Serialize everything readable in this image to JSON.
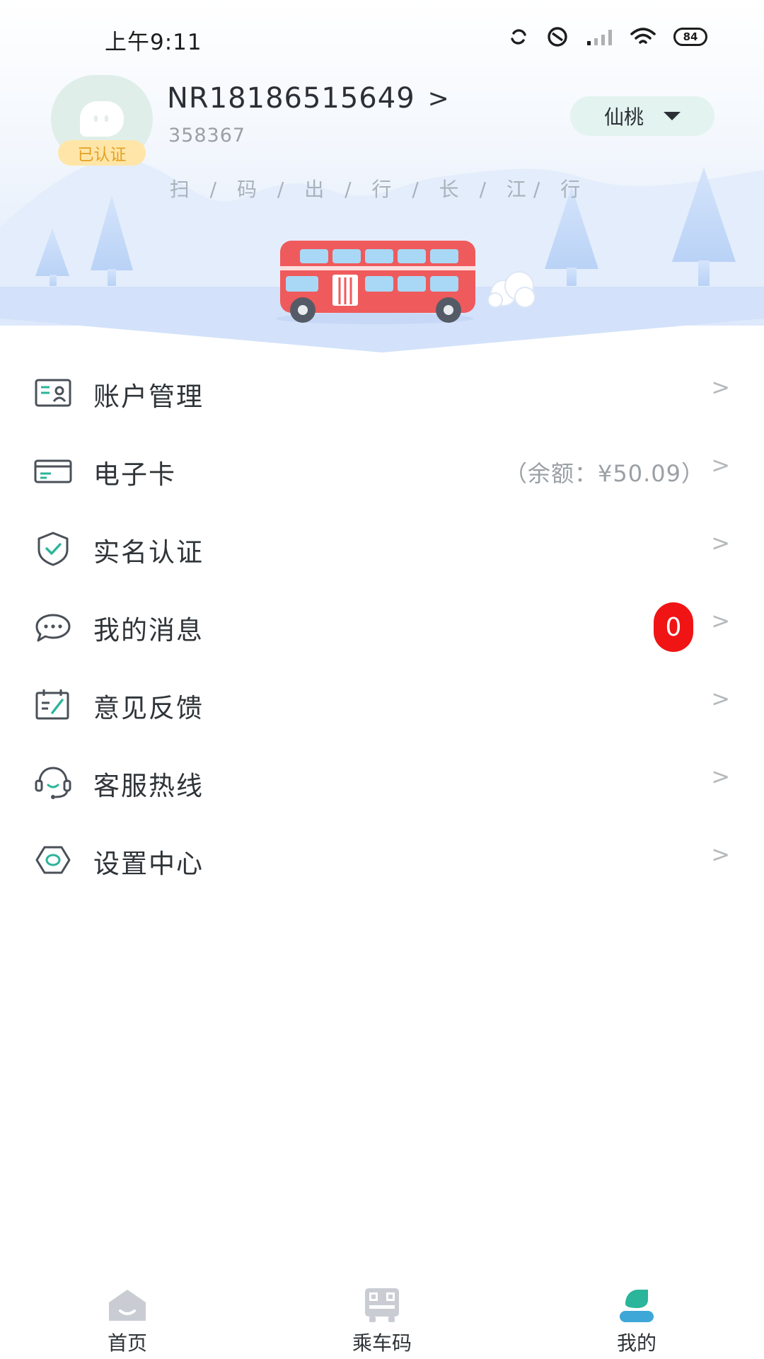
{
  "status_bar": {
    "time": "上午9:11",
    "battery": "84",
    "icons": [
      "sync-icon",
      "do-not-disturb-icon",
      "signal-icon",
      "wifi-icon",
      "battery-icon"
    ]
  },
  "profile": {
    "username": "NR18186515649",
    "chevron": ">",
    "user_id": "358367",
    "verified_badge": "已认证",
    "city": "仙桃"
  },
  "banner": {
    "slogan": "扫 / 码 / 出 / 行 / 长 / 江/ 行"
  },
  "menu": {
    "items": [
      {
        "label": "账户管理",
        "icon": "account-card-icon"
      },
      {
        "label": "电子卡",
        "icon": "e-card-icon",
        "extra": "（余额：¥50.09）"
      },
      {
        "label": "实名认证",
        "icon": "shield-check-icon"
      },
      {
        "label": "我的消息",
        "icon": "message-bubble-icon",
        "badge": "0"
      },
      {
        "label": "意见反馈",
        "icon": "feedback-edit-icon"
      },
      {
        "label": "客服热线",
        "icon": "headset-icon"
      },
      {
        "label": "设置中心",
        "icon": "settings-hexagon-icon"
      }
    ],
    "chevron": ">"
  },
  "bottom_nav": {
    "items": [
      {
        "label": "首页",
        "icon": "home-icon",
        "active": false
      },
      {
        "label": "乘车码",
        "icon": "bus-qr-icon",
        "active": false
      },
      {
        "label": "我的",
        "icon": "profile-icon",
        "active": true
      }
    ]
  },
  "colors": {
    "accent": "#2bb59a",
    "badge_red": "#f01414",
    "verified_bg": "#ffe6a8",
    "verified_text": "#e4a022",
    "city_pill_bg": "#e3f3ef",
    "banner_sky": "#eaf2fd",
    "bus_red": "#ef5a5c"
  }
}
